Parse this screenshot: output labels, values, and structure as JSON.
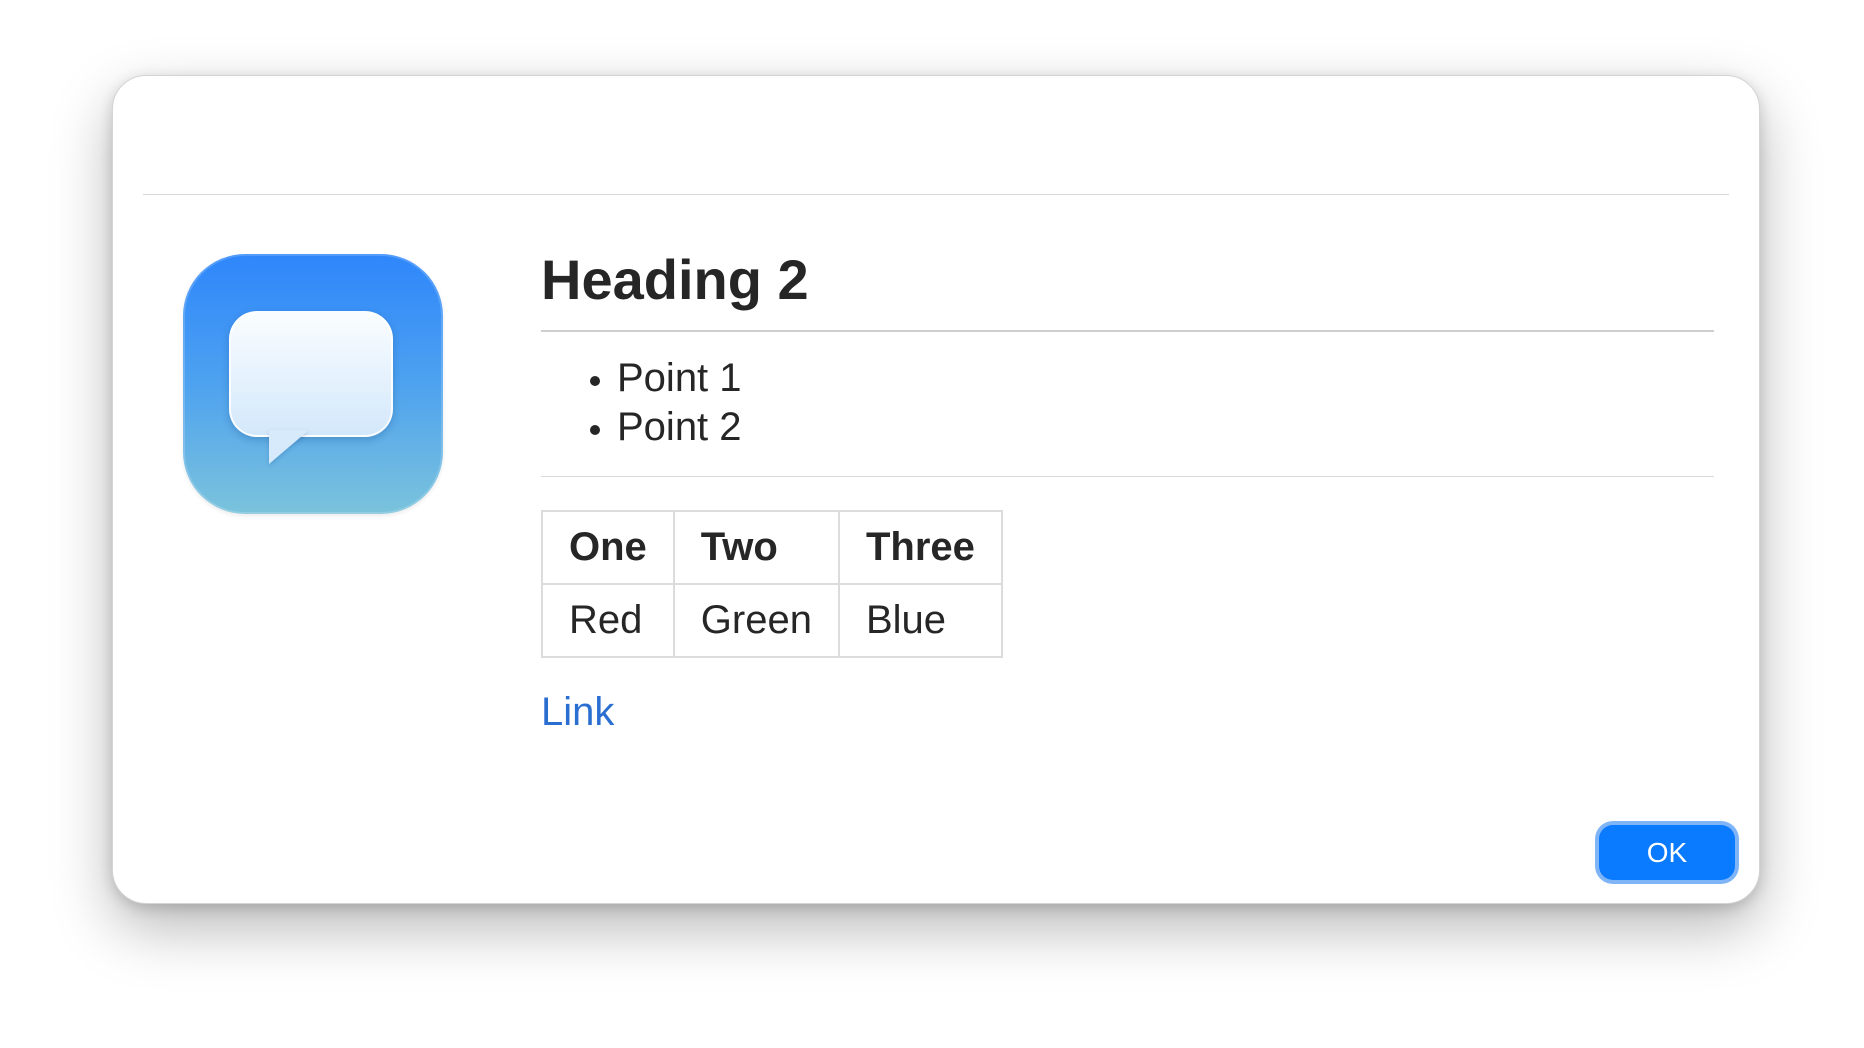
{
  "icons": {
    "app": "speech-bubble-icon"
  },
  "colors": {
    "accent": "#0a7aff",
    "link": "#2b6ed2",
    "icon_gradient_top": "#2e86fb",
    "icon_gradient_bottom": "#7bc3dc"
  },
  "content": {
    "heading": "Heading 2",
    "list": [
      "Point 1",
      "Point 2"
    ],
    "table": {
      "headers": [
        "One",
        "Two",
        "Three"
      ],
      "rows": [
        [
          "Red",
          "Green",
          "Blue"
        ]
      ]
    },
    "link_text": "Link"
  },
  "buttons": {
    "ok_label": "OK"
  }
}
